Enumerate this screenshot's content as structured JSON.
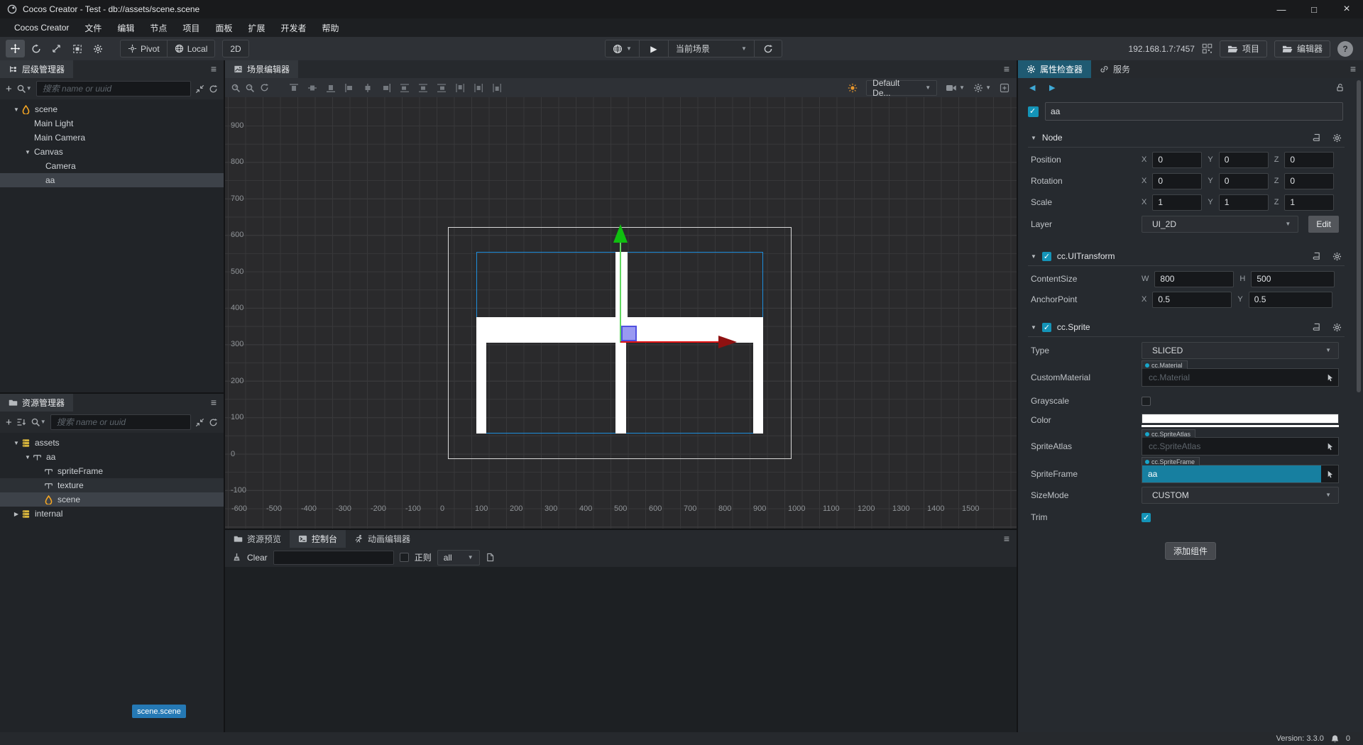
{
  "window": {
    "title": "Cocos Creator - Test - db://assets/scene.scene",
    "minimize": "—",
    "maximize": "□",
    "close": "×"
  },
  "menu": {
    "items": [
      "Cocos Creator",
      "文件",
      "编辑",
      "节点",
      "项目",
      "面板",
      "扩展",
      "开发者",
      "帮助"
    ]
  },
  "toolbar": {
    "pivot": "Pivot",
    "local": "Local",
    "dimension": "2D",
    "scene_dropdown": "当前场景",
    "address": "192.168.1.7:7457",
    "project": "项目",
    "editor": "编辑器",
    "help": "?"
  },
  "hierarchy": {
    "title": "层级管理器",
    "search_placeholder": "搜索 name or uuid",
    "items": [
      {
        "label": "scene",
        "depth": 0,
        "arrow": "down",
        "icon": "scene",
        "selected": false
      },
      {
        "label": "Main Light",
        "depth": 1,
        "arrow": "",
        "icon": "",
        "selected": false
      },
      {
        "label": "Main Camera",
        "depth": 1,
        "arrow": "",
        "icon": "",
        "selected": false
      },
      {
        "label": "Canvas",
        "depth": 1,
        "arrow": "down",
        "icon": "",
        "selected": false
      },
      {
        "label": "Camera",
        "depth": 2,
        "arrow": "",
        "icon": "",
        "selected": false
      },
      {
        "label": "aa",
        "depth": 2,
        "arrow": "",
        "icon": "",
        "selected": true
      }
    ]
  },
  "assets": {
    "title": "资源管理器",
    "search_placeholder": "搜索 name or uuid",
    "items": [
      {
        "label": "assets",
        "depth": 0,
        "arrow": "down",
        "icon": "db",
        "selected": false
      },
      {
        "label": "aa",
        "depth": 1,
        "arrow": "down",
        "icon": "branch",
        "selected": false
      },
      {
        "label": "spriteFrame",
        "depth": 2,
        "arrow": "",
        "icon": "branch",
        "selected": false
      },
      {
        "label": "texture",
        "depth": 2,
        "arrow": "",
        "icon": "branch",
        "selected": false,
        "hover": true
      },
      {
        "label": "scene",
        "depth": 2,
        "arrow": "",
        "icon": "scene",
        "selected": true
      },
      {
        "label": "internal",
        "depth": 0,
        "arrow": "right",
        "icon": "db",
        "selected": false
      }
    ],
    "badge": "scene.scene"
  },
  "scene_editor": {
    "title": "场景编辑器",
    "camera_select": "Default De...",
    "left_ruler": [
      900,
      800,
      700,
      600,
      500,
      400,
      300,
      200,
      100,
      0,
      -100
    ],
    "bottom_ruler": [
      -600,
      -500,
      -400,
      -300,
      -200,
      -100,
      0,
      100,
      200,
      300,
      400,
      500,
      600,
      700,
      800,
      900,
      1000,
      1100,
      1200,
      1300,
      1400,
      1500
    ]
  },
  "console": {
    "tabs": [
      "资源预览",
      "控制台",
      "动画编辑器"
    ],
    "active_tab": "控制台",
    "clear": "Clear",
    "regex": "正则",
    "filter": "all"
  },
  "inspector": {
    "tabs": [
      "属性检查器",
      "服务"
    ],
    "node_name": "aa",
    "axis": {
      "x": "X",
      "y": "Y",
      "z": "Z",
      "w": "W",
      "h": "H"
    },
    "node": {
      "title": "Node",
      "position_label": "Position",
      "position": {
        "x": "0",
        "y": "0",
        "z": "0"
      },
      "rotation_label": "Rotation",
      "rotation": {
        "x": "0",
        "y": "0",
        "z": "0"
      },
      "scale_label": "Scale",
      "scale": {
        "x": "1",
        "y": "1",
        "z": "1"
      },
      "layer_label": "Layer",
      "layer_value": "UI_2D",
      "edit": "Edit"
    },
    "uitransform": {
      "title": "cc.UITransform",
      "content_size_label": "ContentSize",
      "w": "800",
      "h": "500",
      "anchor_label": "AnchorPoint",
      "ax": "0.5",
      "ay": "0.5"
    },
    "sprite": {
      "title": "cc.Sprite",
      "type_label": "Type",
      "type_value": "SLICED",
      "custom_material_label": "CustomMaterial",
      "material_tag": "cc.Material",
      "material_placeholder": "cc.Material",
      "grayscale_label": "Grayscale",
      "color_label": "Color",
      "color_value": "#FFFFFF",
      "atlas_label": "SpriteAtlas",
      "atlas_tag": "cc.SpriteAtlas",
      "atlas_placeholder": "cc.SpriteAtlas",
      "frame_label": "SpriteFrame",
      "frame_tag": "cc.SpriteFrame",
      "frame_value": "aa",
      "sizemode_label": "SizeMode",
      "sizemode_value": "CUSTOM",
      "trim_label": "Trim"
    },
    "add_component": "添加组件"
  },
  "statusbar": {
    "version": "Version: 3.3.0",
    "notification_count": "0"
  },
  "colors": {
    "accent": "#18a5c9",
    "selection": "#3d4249",
    "sprite_border": "#1d8edd",
    "gizmo_green": "#0fbf0f",
    "gizmo_red": "#e01212",
    "gizmo_red_dark": "#8f1111",
    "gizmo_handle": "#8b8bf0",
    "badge_blue": "#2579b5"
  }
}
